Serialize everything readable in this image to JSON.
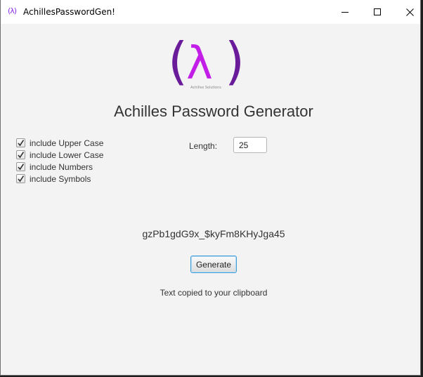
{
  "window": {
    "title": "AchillesPasswordGen!",
    "icon_text": "(λ)",
    "controls": [
      "minimize",
      "maximize",
      "close"
    ]
  },
  "logo": {
    "glyph_left": "(",
    "glyph_center": "λ",
    "glyph_right": ")",
    "caption": "Achilles Solutions",
    "colors": {
      "paren": "#6a1b9a",
      "lambda": "#c21ee8"
    }
  },
  "heading": "Achilles Password Generator",
  "options": [
    {
      "label": "include Upper Case",
      "checked": true
    },
    {
      "label": "include Lower Case",
      "checked": true
    },
    {
      "label": "include Numbers",
      "checked": true
    },
    {
      "label": "include Symbols",
      "checked": true
    }
  ],
  "length": {
    "label": "Length:",
    "value": "25"
  },
  "password": "gzPb1gdG9x_$kyFm8KHyJga45",
  "generate_label": "Generate",
  "status": "Text copied to your clipboard",
  "colors": {
    "accent": "#3e9ed8",
    "background": "#f3f3f3"
  }
}
